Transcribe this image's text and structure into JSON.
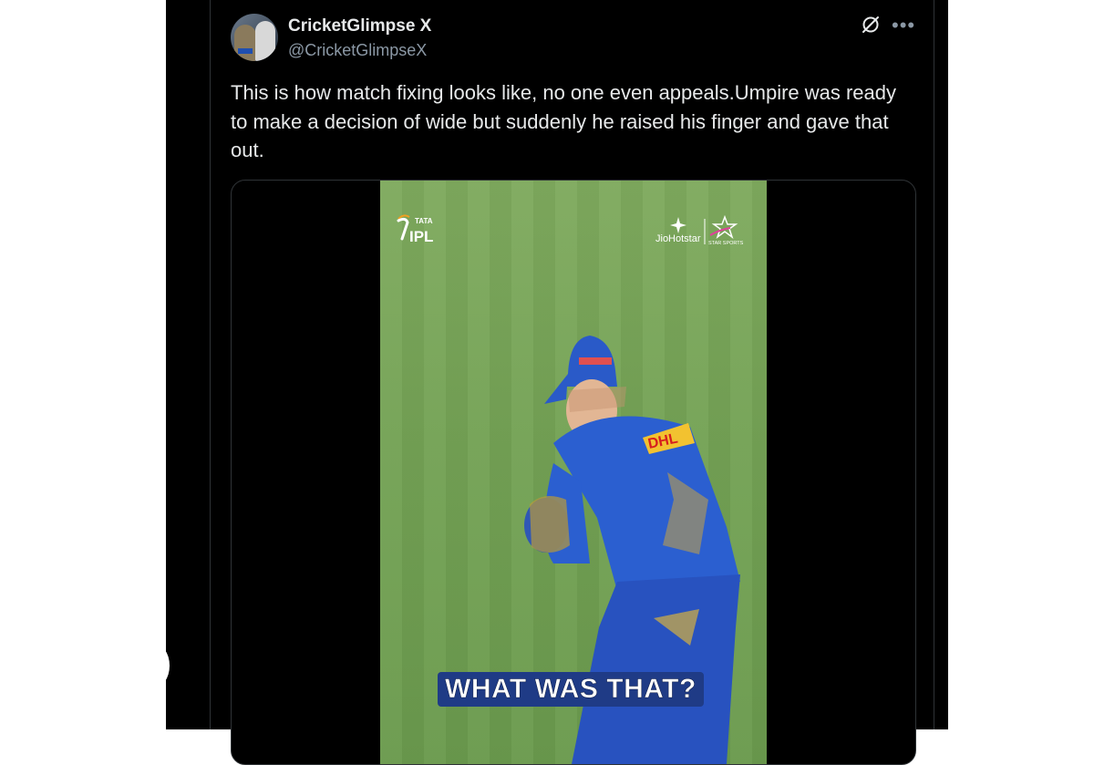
{
  "tweet": {
    "author_name": "CricketGlimpse X",
    "author_handle": "@CricketGlimpseX",
    "text": "This is how match fixing looks like, no one even appeals.Umpire was ready to make a decision of wide but suddenly he raised his finger and gave that out."
  },
  "icons": {
    "header_actions": [
      "grok-icon",
      "more-icon"
    ],
    "more_glyph": "•••"
  },
  "media": {
    "league_logo": {
      "top": "TATA",
      "main": "IPL"
    },
    "broadcaster": {
      "name": "JioHotstar",
      "partner": "STAR SPORTS"
    },
    "jersey_sponsor": "DHL",
    "caption": "WHAT WAS THAT?"
  },
  "colors": {
    "background": "#000000",
    "text": "#e7e9ea",
    "secondary_text": "#8b98a5",
    "border": "#2f3336",
    "caption_bg": "#1f3b86",
    "pitch_green": "#74a255",
    "jersey_blue": "#2b5fd0"
  }
}
